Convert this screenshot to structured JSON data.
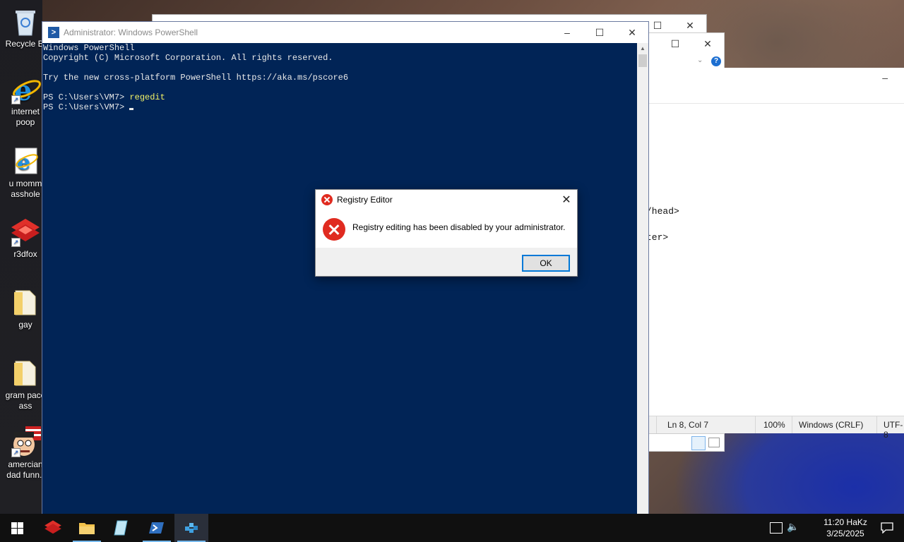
{
  "desktop": {
    "icons": [
      {
        "label": "Recycle Bi",
        "icon": "recycle-bin-icon"
      },
      {
        "label": "internet\npoop",
        "icon": "internet-explorer-icon"
      },
      {
        "label": "u momm\nasshole",
        "icon": "internet-explorer-icon"
      },
      {
        "label": "r3dfox",
        "icon": "r3dfox-icon"
      },
      {
        "label": "gay",
        "icon": "folder-icon"
      },
      {
        "label": "gram pace\nass",
        "icon": "folder-icon"
      },
      {
        "label": "amercian\ndad funn..",
        "icon": "cartoon-face-icon"
      }
    ]
  },
  "powershell": {
    "title": "Administrator: Windows PowerShell",
    "lines": [
      {
        "text": "Windows PowerShell"
      },
      {
        "text": "Copyright (C) Microsoft Corporation. All rights reserved."
      },
      {
        "text": ""
      },
      {
        "text": "Try the new cross-platform PowerShell https://aka.ms/pscore6"
      },
      {
        "text": ""
      },
      {
        "prompt": "PS C:\\Users\\VM7> ",
        "command": "regedit"
      },
      {
        "prompt": "PS C:\\Users\\VM7> ",
        "command": ""
      }
    ]
  },
  "notepad": {
    "visible_text": [
      "/head>",
      "ter>"
    ],
    "status": {
      "position": "Ln 8, Col 7",
      "zoom": "100%",
      "line_ending": "Windows (CRLF)",
      "encoding": "UTF-8"
    }
  },
  "dialog": {
    "title": "Registry Editor",
    "message": "Registry editing has been disabled by your administrator.",
    "ok_label": "OK"
  },
  "taskbar": {
    "apps": [
      "start",
      "r3dfox",
      "file-explorer",
      "notepad",
      "powershell",
      "regedit"
    ],
    "time": "11:20 HaKz",
    "date": "3/25/2025"
  }
}
